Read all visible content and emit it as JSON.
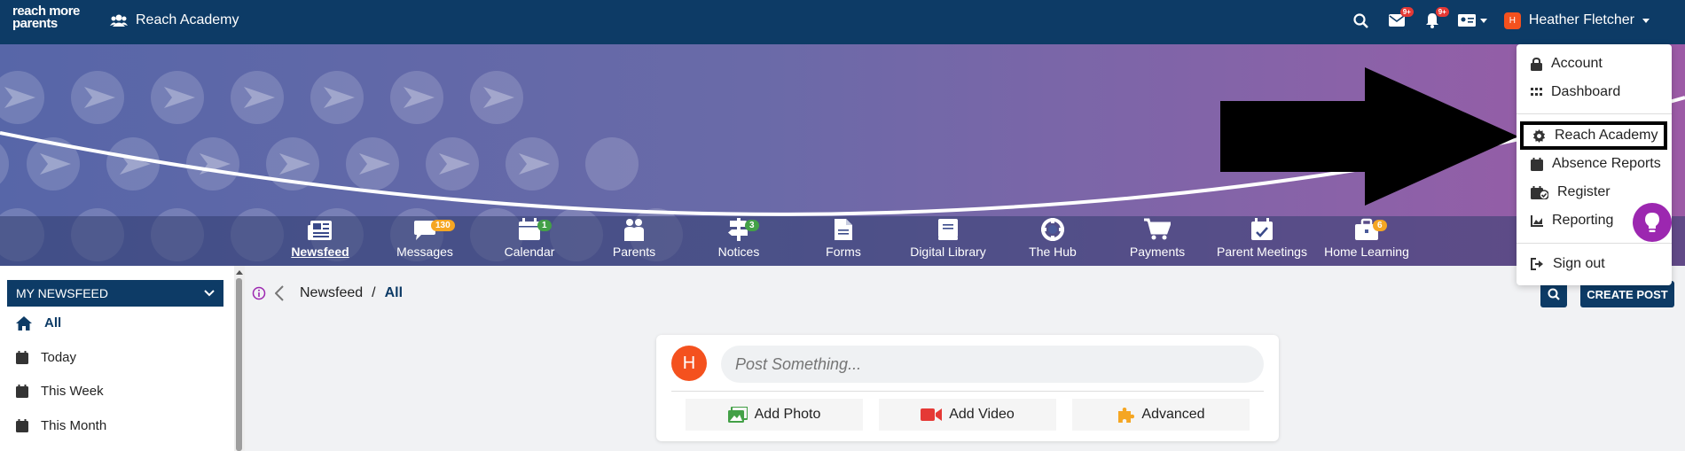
{
  "topbar": {
    "logo_line1": "reach more",
    "logo_line2": "parents",
    "school_name": "Reach Academy",
    "messages_badge": "9+",
    "notifications_badge": "9+",
    "user_initial": "H",
    "user_name": "Heather Fletcher"
  },
  "nav": {
    "items": [
      {
        "label": "Newsfeed",
        "icon": "newspaper-icon",
        "active": true
      },
      {
        "label": "Messages",
        "icon": "chat-icon",
        "badge": "130"
      },
      {
        "label": "Calendar",
        "icon": "calendar-icon",
        "badge": "1"
      },
      {
        "label": "Parents",
        "icon": "users-icon"
      },
      {
        "label": "Notices",
        "icon": "signpost-icon",
        "badge": "3"
      },
      {
        "label": "Forms",
        "icon": "file-icon"
      },
      {
        "label": "Digital Library",
        "icon": "book-icon"
      },
      {
        "label": "The Hub",
        "icon": "lifering-icon"
      },
      {
        "label": "Payments",
        "icon": "cart-icon"
      },
      {
        "label": "Parent Meetings",
        "icon": "calendar-check-icon"
      },
      {
        "label": "Home Learning",
        "icon": "briefcase-icon",
        "badge": "6"
      }
    ]
  },
  "sidebar": {
    "header": "MY NEWSFEED",
    "items": [
      {
        "label": "All",
        "icon": "home-icon"
      },
      {
        "label": "Today",
        "icon": "calendar-icon"
      },
      {
        "label": "This Week",
        "icon": "calendar-icon"
      },
      {
        "label": "This Month",
        "icon": "calendar-icon"
      }
    ]
  },
  "breadcrumb": {
    "root": "Newsfeed",
    "separator": "/",
    "current": "All"
  },
  "main": {
    "create_post_label": "CREATE POST",
    "post_avatar_initial": "H",
    "post_placeholder": "Post Something...",
    "add_photo_label": "Add Photo",
    "add_video_label": "Add Video",
    "advanced_label": "Advanced"
  },
  "dropdown": {
    "items": [
      {
        "label": "Account",
        "icon": "lock-icon"
      },
      {
        "label": "Dashboard",
        "icon": "grid-icon"
      },
      {
        "label": "Reach Academy",
        "icon": "gear-icon",
        "highlighted": true
      },
      {
        "label": "Absence Reports",
        "icon": "calendar-icon"
      },
      {
        "label": "Register",
        "icon": "register-icon"
      },
      {
        "label": "Reporting",
        "icon": "chart-area-icon"
      },
      {
        "label": "Sign out",
        "icon": "sign-out-icon"
      }
    ]
  },
  "colors": {
    "primary": "#0d3b66",
    "avatar": "#f4511e",
    "badge_red": "#e53935",
    "badge_orange": "#f5a623",
    "badge_green": "#43a047",
    "help_purple": "#9c27b0"
  }
}
